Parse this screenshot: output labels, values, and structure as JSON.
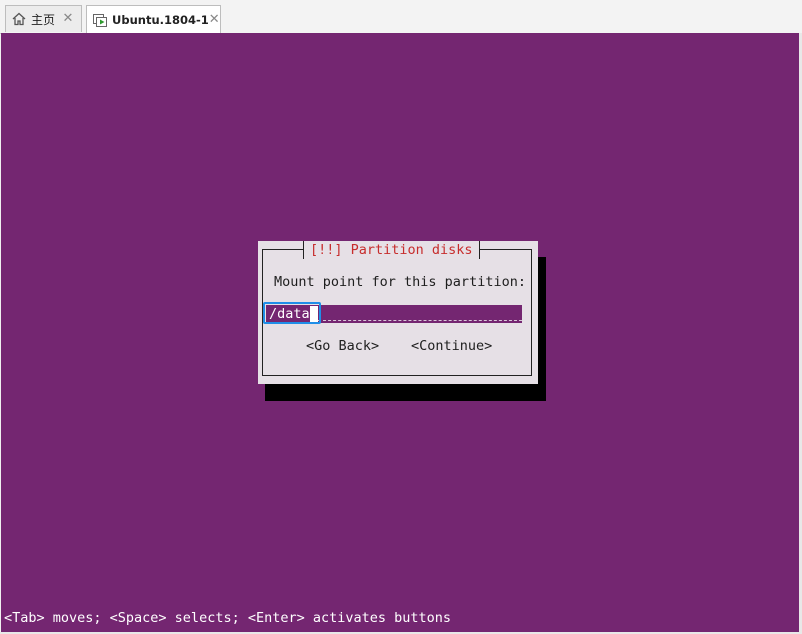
{
  "tabs": [
    {
      "label": "主页",
      "icon": "home-icon",
      "active": false
    },
    {
      "label": "Ubuntu.1804-1",
      "icon": "vm-icon",
      "active": true
    }
  ],
  "dialog": {
    "title": "[!!] Partition disks",
    "prompt": "Mount point for this partition:",
    "input_value": "/data",
    "go_back_label": "<Go Back>",
    "continue_label": "<Continue>"
  },
  "footer": {
    "hint": "<Tab> moves; <Space> selects; <Enter> activates buttons"
  },
  "colors": {
    "console_bg": "#742671",
    "dialog_bg": "#e6e0e6",
    "title_red": "#c72d2d",
    "focus_blue": "#1f8ee8"
  }
}
